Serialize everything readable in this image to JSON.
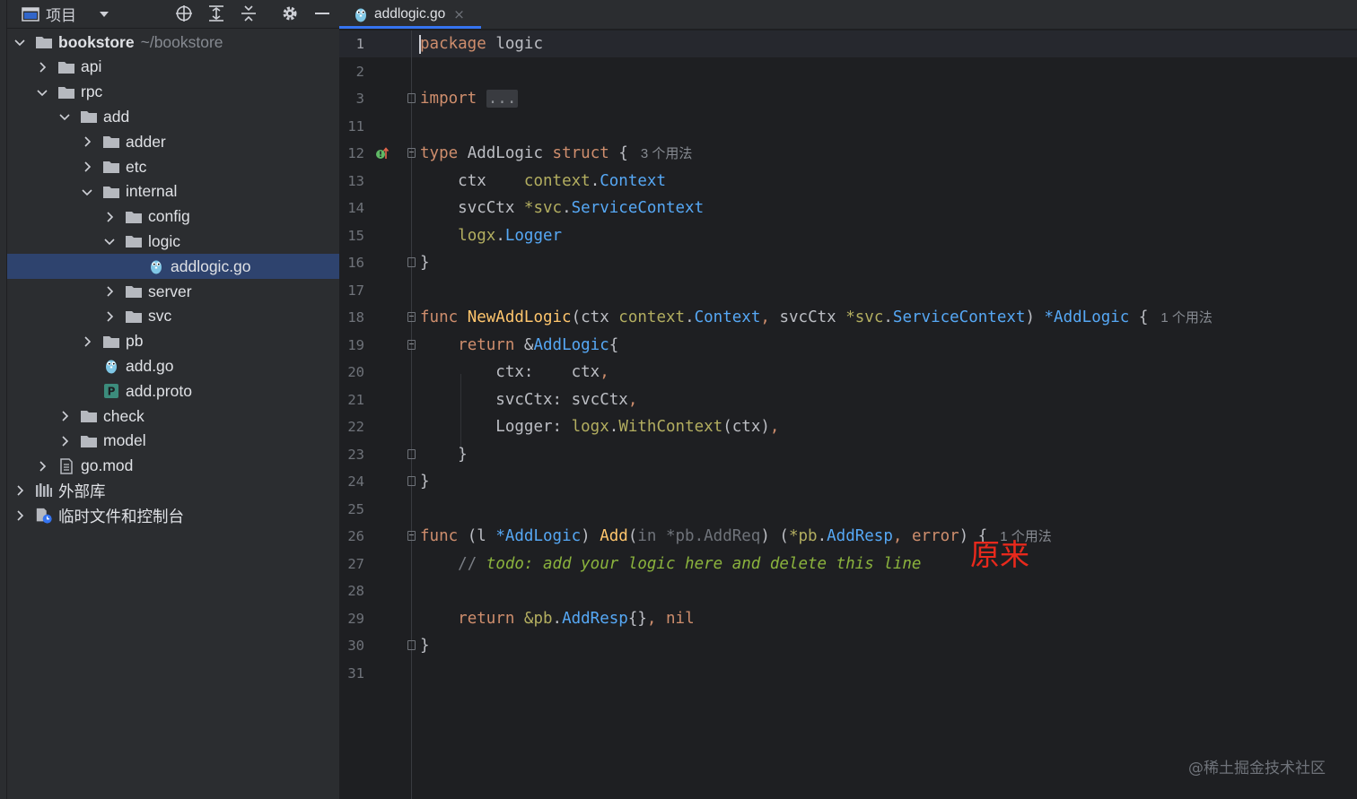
{
  "project_panel": {
    "title": "项目",
    "tree": [
      {
        "label": "bookstore",
        "hint": "~/bookstore",
        "type": "folder",
        "depth": 0,
        "expanded": true,
        "bold": true
      },
      {
        "label": "api",
        "type": "folder",
        "depth": 1,
        "expanded": false
      },
      {
        "label": "rpc",
        "type": "folder",
        "depth": 1,
        "expanded": true
      },
      {
        "label": "add",
        "type": "folder",
        "depth": 2,
        "expanded": true
      },
      {
        "label": "adder",
        "type": "folder",
        "depth": 3,
        "expanded": false
      },
      {
        "label": "etc",
        "type": "folder",
        "depth": 3,
        "expanded": false
      },
      {
        "label": "internal",
        "type": "folder",
        "depth": 3,
        "expanded": true
      },
      {
        "label": "config",
        "type": "folder",
        "depth": 4,
        "expanded": false
      },
      {
        "label": "logic",
        "type": "folder",
        "depth": 4,
        "expanded": true
      },
      {
        "label": "addlogic.go",
        "type": "go",
        "depth": 5,
        "selected": true
      },
      {
        "label": "server",
        "type": "folder",
        "depth": 4,
        "expanded": false
      },
      {
        "label": "svc",
        "type": "folder",
        "depth": 4,
        "expanded": false
      },
      {
        "label": "pb",
        "type": "folder",
        "depth": 3,
        "expanded": false
      },
      {
        "label": "add.go",
        "type": "go",
        "depth": 3
      },
      {
        "label": "add.proto",
        "type": "proto",
        "depth": 3
      },
      {
        "label": "check",
        "type": "folder",
        "depth": 2,
        "expanded": false
      },
      {
        "label": "model",
        "type": "folder",
        "depth": 2,
        "expanded": false
      },
      {
        "label": "go.mod",
        "type": "mod",
        "depth": 1,
        "expanded": false
      },
      {
        "label": "外部库",
        "type": "library",
        "depth": 0,
        "expanded": false
      },
      {
        "label": "临时文件和控制台",
        "type": "scratch",
        "depth": 0,
        "expanded": false
      }
    ]
  },
  "editor": {
    "tab": {
      "label": "addlogic.go",
      "close": "×"
    },
    "usage_hint_3": "3 个用法",
    "usage_hint_1": "1 个用法",
    "line_numbers": [
      "1",
      "2",
      "3",
      "11",
      "12",
      "13",
      "14",
      "15",
      "16",
      "17",
      "18",
      "19",
      "20",
      "21",
      "22",
      "23",
      "24",
      "25",
      "26",
      "27",
      "28",
      "29",
      "30",
      "31"
    ],
    "code": {
      "l1": [
        "package",
        "logic"
      ],
      "l3": [
        "import",
        "..."
      ],
      "l12": [
        "type",
        "AddLogic",
        "struct",
        "{"
      ],
      "l13": [
        "ctx",
        "context",
        ".",
        "Context"
      ],
      "l14": [
        "svcCtx",
        "*svc",
        ".",
        "ServiceContext"
      ],
      "l15": [
        "logx",
        ".",
        "Logger"
      ],
      "l16": "}",
      "l18": [
        "func",
        "NewAddLogic",
        "(ctx ",
        "context",
        ".",
        "Context",
        ",",
        " svcCtx ",
        "*svc",
        ".",
        "ServiceContext",
        ") ",
        "*AddLogic",
        " {"
      ],
      "l19": [
        "return",
        "&",
        "AddLogic",
        "{"
      ],
      "l20": [
        "ctx:",
        "ctx",
        ","
      ],
      "l21": [
        "svcCtx:",
        "svcCtx",
        ","
      ],
      "l22": [
        "Logger:",
        "logx",
        ".",
        "WithContext",
        "(ctx)",
        ","
      ],
      "l23": "}",
      "l24": "}",
      "l26": [
        "func",
        "(l ",
        "*AddLogic",
        ") ",
        "Add",
        "(",
        "in ",
        "*pb.AddReq",
        ") ",
        "(",
        "*pb",
        ".",
        "AddResp",
        ", ",
        "error",
        ") {"
      ],
      "l27": [
        "//",
        "todo: add your logic here and delete this line"
      ],
      "l29": [
        "return",
        "&pb",
        ".",
        "AddResp",
        "{}",
        ", ",
        "nil"
      ],
      "l30": "}"
    }
  },
  "annotation": "原来",
  "watermark": "@稀土掘金技术社区",
  "colors": {
    "accent": "#3574f0",
    "selection": "#2e436e",
    "annotation": "#e8291c"
  }
}
